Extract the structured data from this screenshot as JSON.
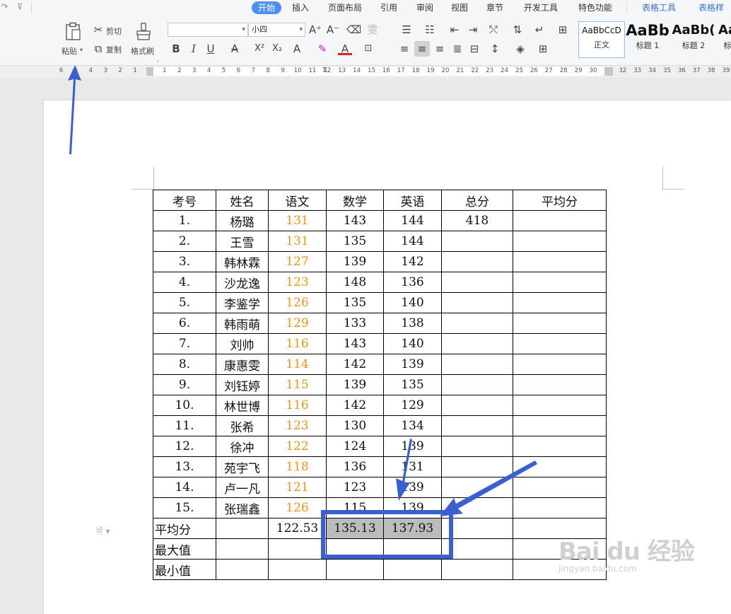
{
  "tabs": [
    "开始",
    "插入",
    "页面布局",
    "引用",
    "审阅",
    "视图",
    "章节",
    "开发工具",
    "特色功能",
    "表格工具",
    "表格样式"
  ],
  "quick_access": {
    "dropdown_glyph": "⊽"
  },
  "ribbon": {
    "clipboard": {
      "paste": "粘贴",
      "cut": "剪切",
      "copy": "复制",
      "format_painter": "格式刷"
    },
    "font": {
      "name_value": "",
      "size_value": "小四"
    },
    "styles": [
      {
        "preview": "AaBbCcD",
        "caption": "正文"
      },
      {
        "preview": "AaBb",
        "caption": "标题 1"
      },
      {
        "preview": "AaBb(",
        "caption": "标题 2"
      },
      {
        "preview": "Aa",
        "caption": "标"
      }
    ]
  },
  "ruler": {
    "left_numbers": [
      "6",
      "5",
      "4",
      "3",
      "2",
      "1"
    ],
    "right_numbers": [
      "1",
      "2",
      "3",
      "4",
      "5",
      "6",
      "7",
      "8",
      "9",
      "10",
      "11",
      "12",
      "13",
      "14",
      "15",
      "16",
      "17",
      "18",
      "19",
      "20",
      "21",
      "22",
      "23",
      "24",
      "25",
      "26",
      "27",
      "28",
      "29",
      "30",
      "",
      "32",
      "33",
      "34",
      "35",
      "36",
      "37",
      "38",
      "39"
    ]
  },
  "table": {
    "headers": [
      "考号",
      "姓名",
      "语文",
      "数学",
      "英语",
      "总分",
      "平均分"
    ],
    "rows": [
      [
        "1.",
        "杨璐",
        "131",
        "143",
        "144",
        "418",
        ""
      ],
      [
        "2.",
        "王雪",
        "131",
        "135",
        "144",
        "",
        ""
      ],
      [
        "3.",
        "韩林霖",
        "127",
        "139",
        "142",
        "",
        ""
      ],
      [
        "4.",
        "沙龙逸",
        "123",
        "148",
        "136",
        "",
        ""
      ],
      [
        "5.",
        "李鉴学",
        "126",
        "135",
        "140",
        "",
        ""
      ],
      [
        "6.",
        "韩雨萌",
        "129",
        "133",
        "138",
        "",
        ""
      ],
      [
        "7.",
        "刘帅",
        "116",
        "143",
        "140",
        "",
        ""
      ],
      [
        "8.",
        "康惠雯",
        "114",
        "142",
        "139",
        "",
        ""
      ],
      [
        "9.",
        "刘钰婷",
        "115",
        "139",
        "135",
        "",
        ""
      ],
      [
        "10.",
        "林世博",
        "116",
        "142",
        "129",
        "",
        ""
      ],
      [
        "11.",
        "张希",
        "123",
        "130",
        "134",
        "",
        ""
      ],
      [
        "12.",
        "徐冲",
        "122",
        "124",
        "139",
        "",
        ""
      ],
      [
        "13.",
        "苑宇飞",
        "118",
        "136",
        "131",
        "",
        ""
      ],
      [
        "14.",
        "卢一凡",
        "121",
        "123",
        "139",
        "",
        ""
      ],
      [
        "15.",
        "张瑞鑫",
        "126",
        "115",
        "139",
        "",
        ""
      ]
    ],
    "summary": [
      {
        "label": "平均分",
        "cells": [
          "",
          "122.53",
          "135.13",
          "137.93",
          "",
          ""
        ]
      },
      {
        "label": "最大值",
        "cells": [
          "",
          "",
          "",
          "",
          "",
          ""
        ]
      },
      {
        "label": "最小值",
        "cells": [
          "",
          "",
          "",
          "",
          "",
          ""
        ]
      }
    ],
    "selected_cells": [
      "135.13",
      "137.93"
    ],
    "orange_column": "语文"
  },
  "watermark": {
    "main": "Bai du 经验",
    "url": "jingyan.baidu.com"
  },
  "colors": {
    "accent": "#4f8ff0",
    "tool_tab": "#3a72c8",
    "orange_values": "#e3951b",
    "annotation_blue": "#3a5fd0",
    "selection_gray": "#bcbcbc"
  }
}
